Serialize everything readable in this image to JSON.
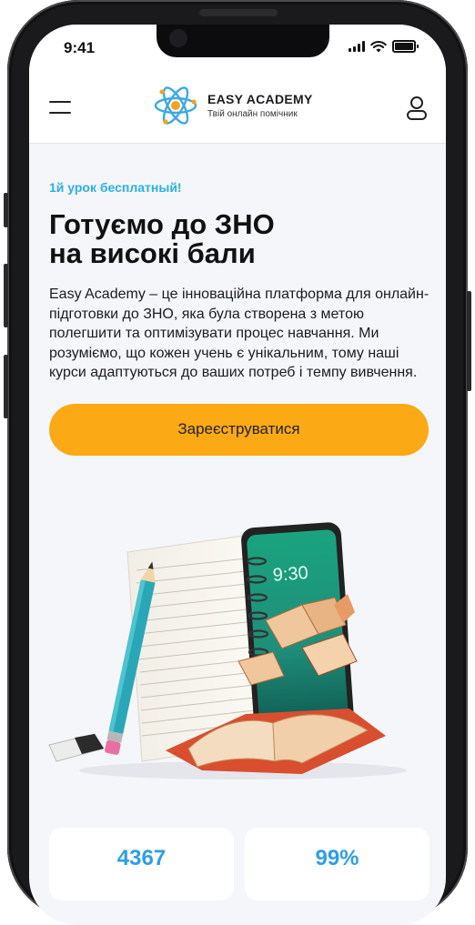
{
  "status_bar": {
    "time": "9:41"
  },
  "header": {
    "brand_name": "EASY ACADEMY",
    "brand_tagline": "Твій онлайн помічник"
  },
  "hero": {
    "promo": "1й урок бесплатный!",
    "title_line1": "Готуємо до ЗНО",
    "title_line2": "на високі бали",
    "description": "Easy Academy – це інноваційна платформа для онлайн-підготовки до ЗНО, яка була створена з метою полегшити та оптимізувати процес навчання. Ми розуміємо, що кожен учень є унікальним, тому наші курси адаптуються до ваших потреб і темпу вивчення.",
    "cta_label": "Зареєструватися"
  },
  "illustration": {
    "phone_time": "9:30"
  },
  "stats": [
    {
      "value": "4367"
    },
    {
      "value": "99%"
    }
  ],
  "colors": {
    "accent": "#fba914",
    "promo": "#2ab0e8",
    "stat": "#2d9ee6",
    "background": "#f5f6fa"
  },
  "icons": [
    "menu-icon",
    "atom-logo-icon",
    "user-icon",
    "signal-icon",
    "wifi-icon",
    "battery-icon"
  ]
}
